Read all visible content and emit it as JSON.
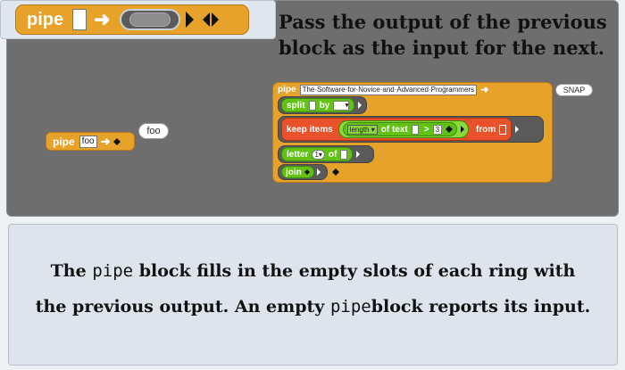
{
  "header": {
    "pipe_label": "pipe",
    "arrow": "➜",
    "headline_line1": "Pass the output of the previous",
    "headline_line2": "block as the input for the next."
  },
  "example_small": {
    "pipe_label": "pipe",
    "input_value": "foo",
    "arrow": "➜",
    "result": "foo"
  },
  "example_big": {
    "pipe_label": "pipe",
    "input_value": "The·Software·for·Novice·and·Advanced·Programmers",
    "arrow": "➜",
    "result": "SNAP",
    "split": {
      "label": "split",
      "by_label": "by"
    },
    "keep": {
      "label": "keep items",
      "length_option": "length",
      "of_text_label": "of text",
      "gt_label": ">",
      "gt_value": "3",
      "from_label": "from"
    },
    "letter": {
      "label": "letter",
      "index_value": "1",
      "of_label": "of"
    },
    "join": {
      "label": "join"
    }
  },
  "caption": {
    "line1_pre": "The",
    "line1_code": "pipe",
    "line1_post": "block fills in the empty slots of each ring with",
    "line2_pre": "the previous output. An empty",
    "line2_code": "pipe",
    "line2_post": "block reports its input."
  },
  "colors": {
    "operators": "#62c213",
    "control": "#e6a229",
    "lists": "#e9512a",
    "stage_bg": "#6e6e6e"
  }
}
